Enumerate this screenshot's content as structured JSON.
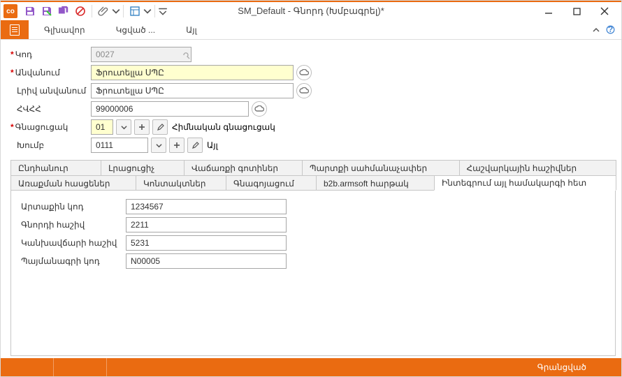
{
  "window": {
    "title": "SM_Default - Գնորդ (Խմբագրել)*",
    "app_icon_label": "co"
  },
  "menubar": {
    "items": [
      "Գլխավոր",
      "Կցված ...",
      "Այլ"
    ]
  },
  "form": {
    "code_label": "Կոդ",
    "code_value": "0027",
    "name_label": "Անվանում",
    "name_value": "Ֆրուտելլա ՍՊԸ",
    "fullname_label": "Լրիվ անվանում",
    "fullname_value": "Ֆրուտելլա ՍՊԸ",
    "tax_label": "ՀՎՀՀ",
    "tax_value": "99000006",
    "pricelist_label": "Գնացուցակ",
    "pricelist_code": "01",
    "pricelist_name": "Հիմնական գնացուցակ",
    "group_label": "Խումբ",
    "group_code": "0111",
    "group_name": "Այլ"
  },
  "tabs": {
    "row1": [
      "Ընդհանուր",
      "Լրացուցիչ",
      "Վաճառքի գոտիներ",
      "Պարտքի սահմանաչափեր",
      "Հաշվարկային հաշիվներ"
    ],
    "row2": [
      "Առաքման հասցեներ",
      "Կոնտակտներ",
      "Գնագոյացում",
      "b2b.armsoft հարթակ",
      "Ինտեգրում այլ համակարգի հետ"
    ],
    "active": "Ինտեգրում այլ համակարգի հետ"
  },
  "detail": {
    "ext_code_label": "Արտաքին կոդ",
    "ext_code_value": "1234567",
    "buyer_acc_label": "Գնորդի հաշիվ",
    "buyer_acc_value": "2211",
    "prepay_acc_label": "Կանխավճարի հաշիվ",
    "prepay_acc_value": "5231",
    "contract_label": "Պայմանագրի կոդ",
    "contract_value": "N00005"
  },
  "status": {
    "text": "Գրանցված"
  }
}
